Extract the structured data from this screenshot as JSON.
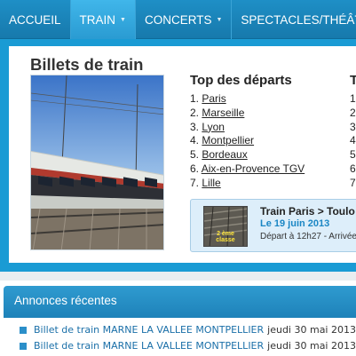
{
  "nav": {
    "items": [
      {
        "label": "ACCUEIL",
        "active": false,
        "has_menu": false
      },
      {
        "label": "TRAIN",
        "active": true,
        "has_menu": true
      },
      {
        "label": "CONCERTS",
        "active": false,
        "has_menu": true
      },
      {
        "label": "SPECTACLES/THÉÂT",
        "active": false,
        "has_menu": false
      }
    ]
  },
  "panel": {
    "title": "Billets de train",
    "top_departs": {
      "title": "Top des départs",
      "items": [
        {
          "num": "1.",
          "city": "Paris"
        },
        {
          "num": "2.",
          "city": "Marseille"
        },
        {
          "num": "3.",
          "city": "Lyon"
        },
        {
          "num": "4.",
          "city": "Montpellier"
        },
        {
          "num": "5.",
          "city": "Bordeaux"
        },
        {
          "num": "6.",
          "city": "Aix-en-Provence TGV"
        },
        {
          "num": "7.",
          "city": "Lille"
        }
      ]
    },
    "second_col": {
      "title": "T",
      "nums": [
        "1",
        "2",
        "3",
        "4",
        "5",
        "6",
        "7"
      ]
    },
    "trip": {
      "title": "Train Paris > Toulo",
      "date": "Le 19 juin 2013",
      "time": "Départ à 12h27 - Arrivée",
      "badge_line1": "2 ème",
      "badge_line2": "classe"
    }
  },
  "annonces": {
    "title": "Annonces récentes",
    "items": [
      {
        "text": "Billet de train MARNE LA VALLEE MONTPELLIER",
        "date": "jeudi 30 mai 2013"
      },
      {
        "text": "Billet de train MARNE LA VALLEE MONTPELLIER",
        "date": "jeudi 30 mai 2013"
      }
    ]
  },
  "colors": {
    "nav_bg": "#1e8fc6",
    "nav_active": "#40b6ea",
    "accent_blue": "#1a86c4",
    "trip_box_bg": "#ddeefa"
  }
}
